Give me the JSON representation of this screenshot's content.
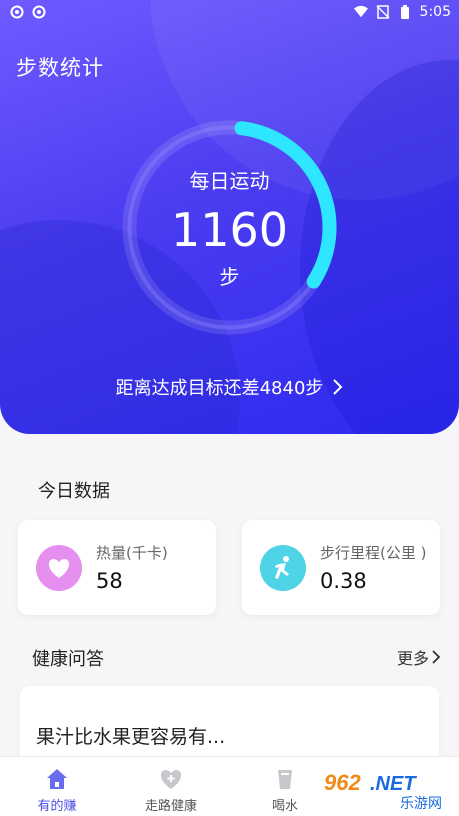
{
  "status_bar": {
    "time": "5:05"
  },
  "header": {
    "title": "步数统计"
  },
  "ring": {
    "label": "每日运动",
    "steps": "1160",
    "unit": "步",
    "progress": 0.195
  },
  "goal": {
    "text": "距离达成目标还差4840步"
  },
  "today": {
    "title": "今日数据",
    "calories": {
      "label": "热量(千卡)",
      "value": "58"
    },
    "distance": {
      "label": "步行里程(公里 )",
      "value": "0.38"
    }
  },
  "qa": {
    "title": "健康问答",
    "more": "更多",
    "first_question": "果汁比水果更容易有..."
  },
  "tabs": [
    {
      "label": "有的赚",
      "icon": "home-icon"
    },
    {
      "label": "走路健康",
      "icon": "heart-plus-icon"
    },
    {
      "label": "喝水",
      "icon": "cup-icon"
    }
  ],
  "watermark": {
    "text": "962.NET 乐游网"
  },
  "colors": {
    "primary": "#4c4be8",
    "ring": "#2ee6ff",
    "heart_bg": "#e58ff0",
    "run_bg": "#4fd3e6"
  }
}
